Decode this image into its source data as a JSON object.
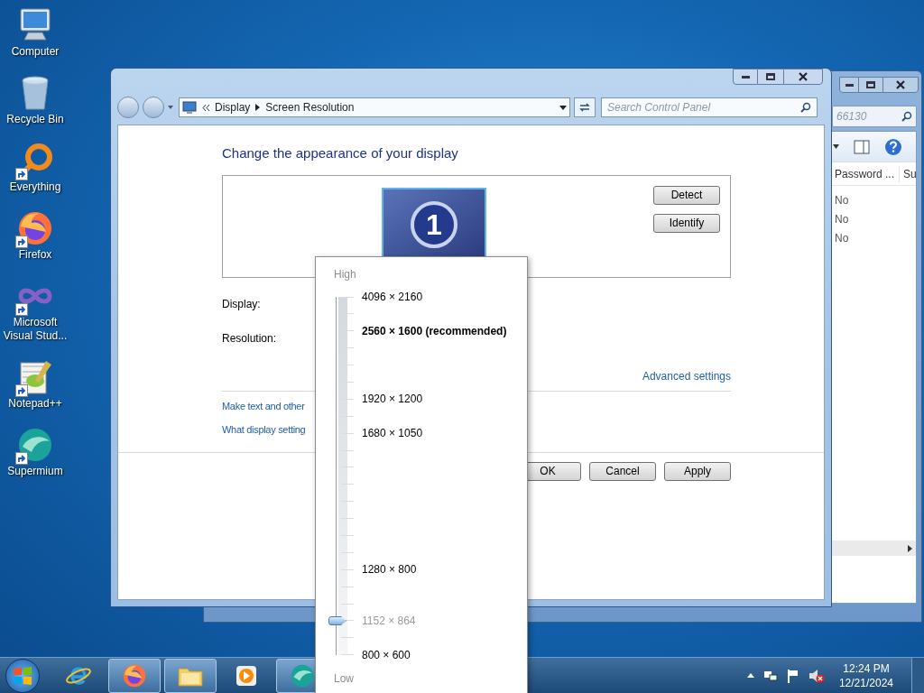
{
  "desktop_icons": [
    {
      "label": "Computer",
      "kind": "computer",
      "shortcut": false
    },
    {
      "label": "Recycle Bin",
      "kind": "recycle",
      "shortcut": false
    },
    {
      "label": "Everything",
      "kind": "everything",
      "shortcut": true
    },
    {
      "label": "Firefox",
      "kind": "firefox",
      "shortcut": true
    },
    {
      "label": "Microsoft Visual Stud...",
      "kind": "vs",
      "shortcut": true
    },
    {
      "label": "Notepad++",
      "kind": "notepad",
      "shortcut": true
    },
    {
      "label": "Supermium",
      "kind": "supermium",
      "shortcut": true
    }
  ],
  "back_window": {
    "search_placeholder": "66130",
    "columns": [
      "Password ...",
      "Su"
    ],
    "rows": [
      "No",
      "No",
      "No"
    ]
  },
  "window": {
    "breadcrumb": [
      "Display",
      "Screen Resolution"
    ],
    "search_placeholder": "Search Control Panel",
    "heading": "Change the appearance of your display",
    "monitor_number": "1",
    "side_buttons": [
      "Detect",
      "Identify"
    ],
    "fields": [
      "Display:",
      "Resolution:"
    ],
    "advanced_link": "Advanced settings",
    "links": [
      "Make text and other",
      "What display setting"
    ],
    "buttons": [
      "OK",
      "Cancel",
      "Apply"
    ]
  },
  "resolution_popup": {
    "high_label": "High",
    "low_label": "Low",
    "level": 0.096,
    "ticks": [
      {
        "kind": "labeled",
        "label": "4096 × 2160",
        "recommended": false,
        "selected": false
      },
      {
        "kind": "blank"
      },
      {
        "kind": "labeled",
        "label": "2560 × 1600 (recommended)",
        "recommended": true,
        "selected": false
      },
      {
        "kind": "blank"
      },
      {
        "kind": "blank"
      },
      {
        "kind": "blank"
      },
      {
        "kind": "labeled",
        "label": "1920 × 1200",
        "recommended": false,
        "selected": false
      },
      {
        "kind": "blank"
      },
      {
        "kind": "labeled",
        "label": "1680 × 1050",
        "recommended": false,
        "selected": false
      },
      {
        "kind": "blank"
      },
      {
        "kind": "blank"
      },
      {
        "kind": "blank"
      },
      {
        "kind": "blank"
      },
      {
        "kind": "blank"
      },
      {
        "kind": "blank"
      },
      {
        "kind": "blank"
      },
      {
        "kind": "labeled",
        "label": "1280 × 800",
        "recommended": false,
        "selected": false
      },
      {
        "kind": "blank"
      },
      {
        "kind": "blank"
      },
      {
        "kind": "labeled",
        "label": "1152 × 864",
        "recommended": false,
        "selected": true
      },
      {
        "kind": "blank"
      },
      {
        "kind": "labeled",
        "label": "800 × 600",
        "recommended": false,
        "selected": false
      }
    ]
  },
  "taskbar": {
    "apps": [
      {
        "kind": "ie",
        "running": false
      },
      {
        "kind": "firefox",
        "running": true
      },
      {
        "kind": "explorer",
        "running": true
      },
      {
        "kind": "media",
        "running": false
      },
      {
        "kind": "supermium",
        "running": true
      }
    ],
    "time": "12:24 PM",
    "date": "12/21/2024"
  }
}
